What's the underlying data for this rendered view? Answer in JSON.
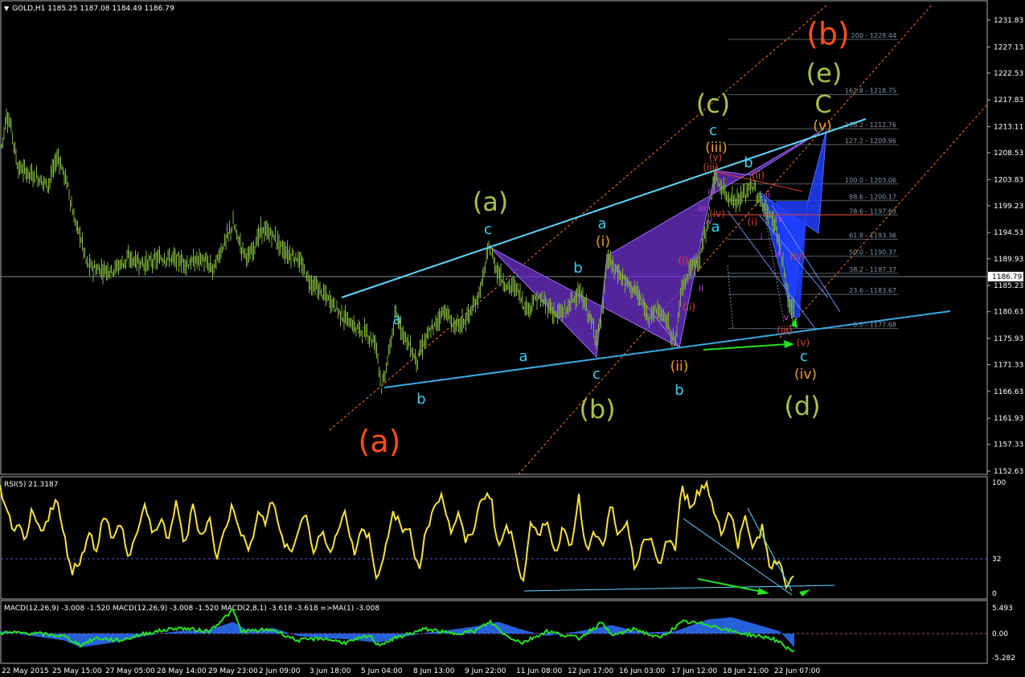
{
  "header": {
    "symbol_line": "GOLD,H1  1185.25 1187.08 1184.49 1186.79",
    "current_price": "1186.79"
  },
  "colors": {
    "background": "#000000",
    "candles": "#7fb33b",
    "trendline": "#5fd7ff",
    "pattern_purple": "#6a2fc7",
    "pattern_blue": "#1e40ff",
    "rsi": "#f5e33d",
    "macd_hist": "#2b6cf2",
    "macd_signal": "#28e028",
    "fib_channel": "#ff7f27",
    "wave_major": "#ff4f1a",
    "wave_green": "#a8c24a",
    "wave_cyan": "#38d0f0",
    "wave_orange": "#f0a020",
    "wave_red": "#e0402c",
    "wave_magenta": "#c040e0",
    "arrow_green": "#22e022"
  },
  "chart_data": [
    {
      "type": "candlestick",
      "title": "GOLD,H1",
      "ohlc_current": {
        "open": 1185.25,
        "high": 1187.08,
        "low": 1184.49,
        "close": 1186.79
      },
      "ylim": [
        1150.0,
        1234.5
      ],
      "y_ticks": [
        "1231.83",
        "1227.13",
        "1222.53",
        "1217.83",
        "1213.11",
        "1208.53",
        "1203.83",
        "1199.23",
        "1194.53",
        "1189.93",
        "1185.23",
        "1180.63",
        "1175.93",
        "1171.33",
        "1166.63",
        "1161.93",
        "1157.33",
        "1152.63"
      ],
      "x_ticks": [
        "22 May 2015",
        "25 May 15:00",
        "27 May 05:00",
        "28 May 14:00",
        "29 May 23:00",
        "2 Jun 09:00",
        "3 Jun 18:00",
        "5 Jun 04:00",
        "8 Jun 13:00",
        "9 Jun 22:00",
        "11 Jun 08:00",
        "12 Jun 17:00",
        "16 Jun 03:00",
        "17 Jun 12:00",
        "18 Jun 21:00",
        "22 Jun 07:00"
      ],
      "price_path": [
        [
          0,
          1208.0
        ],
        [
          8,
          1215.0
        ],
        [
          14,
          1213.0
        ],
        [
          22,
          1206.0
        ],
        [
          35,
          1205.0
        ],
        [
          48,
          1204.0
        ],
        [
          60,
          1203.0
        ],
        [
          72,
          1208.0
        ],
        [
          84,
          1203.0
        ],
        [
          92,
          1197.0
        ],
        [
          100,
          1194.0
        ],
        [
          108,
          1189.0
        ],
        [
          120,
          1188.0
        ],
        [
          140,
          1188.0
        ],
        [
          160,
          1190.0
        ],
        [
          180,
          1189.0
        ],
        [
          200,
          1190.0
        ],
        [
          215,
          1190.0
        ],
        [
          235,
          1189.0
        ],
        [
          250,
          1190.0
        ],
        [
          265,
          1188.0
        ],
        [
          280,
          1193.0
        ],
        [
          290,
          1196.0
        ],
        [
          300,
          1192.0
        ],
        [
          310,
          1190.0
        ],
        [
          325,
          1195.0
        ],
        [
          340,
          1194.0
        ],
        [
          355,
          1191.0
        ],
        [
          370,
          1190.0
        ],
        [
          385,
          1186.0
        ],
        [
          400,
          1184.0
        ],
        [
          415,
          1182.0
        ],
        [
          425,
          1180.0
        ],
        [
          440,
          1178.0
        ],
        [
          455,
          1177.0
        ],
        [
          468,
          1175.0
        ],
        [
          475,
          1167.0
        ],
        [
          482,
          1172.0
        ],
        [
          492,
          1180.0
        ],
        [
          505,
          1176.0
        ],
        [
          518,
          1172.0
        ],
        [
          530,
          1176.0
        ],
        [
          540,
          1178.0
        ],
        [
          552,
          1181.0
        ],
        [
          565,
          1178.0
        ],
        [
          578,
          1179.0
        ],
        [
          592,
          1182.0
        ],
        [
          600,
          1186.0
        ],
        [
          608,
          1192.0
        ],
        [
          618,
          1188.0
        ],
        [
          630,
          1185.0
        ],
        [
          642,
          1185.0
        ],
        [
          655,
          1181.0
        ],
        [
          668,
          1183.0
        ],
        [
          680,
          1182.0
        ],
        [
          692,
          1180.0
        ],
        [
          705,
          1181.0
        ],
        [
          718,
          1184.0
        ],
        [
          728,
          1182.0
        ],
        [
          735,
          1179.0
        ],
        [
          742,
          1176.0
        ],
        [
          750,
          1181.0
        ],
        [
          755,
          1190.0
        ],
        [
          765,
          1188.0
        ],
        [
          778,
          1186.0
        ],
        [
          792,
          1184.0
        ],
        [
          805,
          1180.0
        ],
        [
          818,
          1181.0
        ],
        [
          830,
          1179.0
        ],
        [
          840,
          1175.0
        ],
        [
          848,
          1185.0
        ],
        [
          858,
          1188.0
        ],
        [
          870,
          1190.0
        ],
        [
          880,
          1196.0
        ],
        [
          888,
          1204.0
        ],
        [
          895,
          1203.0
        ],
        [
          905,
          1201.0
        ],
        [
          915,
          1200.0
        ],
        [
          925,
          1201.0
        ],
        [
          935,
          1203.0
        ],
        [
          945,
          1200.0
        ],
        [
          955,
          1198.0
        ],
        [
          965,
          1196.0
        ],
        [
          975,
          1188.0
        ],
        [
          983,
          1181.0
        ],
        [
          990,
          1181.0
        ]
      ],
      "annotations": {
        "major_b": "(b)",
        "major_a": "(a)",
        "wave_e": "(e)",
        "wave_d": "(d)",
        "wave_c_big": "(c)",
        "wave_a_big": "(a)",
        "wave_b_big": "(b)",
        "big_C": "C",
        "cyan_c1": "c",
        "cyan_a1": "a",
        "cyan_b1": "b",
        "cyan_a2": "a",
        "cyan_c2": "c",
        "cyan_b2": "b",
        "cyan_a3": "a",
        "cyan_b3": "b",
        "cyan_c3": "c",
        "cyan_a4": "a",
        "cyan_c4": "c",
        "cyan_b4": "b",
        "orange_i": "(i)",
        "orange_ii": "(ii)",
        "orange_iii": "(iii)",
        "orange_iv": "(iv)",
        "orange_v": "(v)",
        "red_i1": "(i)",
        "red_ii1": "(ii)",
        "red_iii1": "(iii)",
        "red_iv1": "(iv)",
        "red_v1": "(v)",
        "red_i2": "(i)",
        "red_ii2": "(ii)",
        "red_iii2": "(iii)",
        "red_iv2": "(iv)",
        "red_v2": "(v)",
        "mag_i1": "i",
        "mag_ii1": "ii",
        "mag_iii1": "iii",
        "mag_iv1": "iv",
        "mag_v1": "v",
        "mag_i2": "i",
        "mag_ii2": "ii",
        "mag_iii2": "iii",
        "mag_iv2": "iv",
        "mag_v2": "v"
      },
      "fib_levels": [
        {
          "label": "200 - 1228.44",
          "value": 1228.44
        },
        {
          "label": "161.8 - 1218.75",
          "value": 1218.75
        },
        {
          "label": "138.2 - 1212.76",
          "value": 1212.76
        },
        {
          "label": "127.2 - 1209.96",
          "value": 1209.96
        },
        {
          "label": "100.0 - 1203.06",
          "value": 1203.06
        },
        {
          "label": "88.6 - 1200.17",
          "value": 1200.17
        },
        {
          "label": "78.6 - 1197.63",
          "value": 1197.63
        },
        {
          "label": "61.8 - 1193.36",
          "value": 1193.36
        },
        {
          "label": "50.0 - 1190.37",
          "value": 1190.37
        },
        {
          "label": "38.2 - 1187.37",
          "value": 1187.37
        },
        {
          "label": "23.6 - 1183.67",
          "value": 1183.67
        },
        {
          "label": "0.0 - 1177.68",
          "value": 1177.68
        }
      ]
    },
    {
      "type": "line",
      "title": "RSI(5) 21.3187",
      "ylim": [
        0,
        100
      ],
      "y_ticks": [
        "100",
        "32",
        "0"
      ],
      "level": 32,
      "path": [
        [
          0,
          95
        ],
        [
          8,
          80
        ],
        [
          16,
          50
        ],
        [
          24,
          60
        ],
        [
          32,
          45
        ],
        [
          40,
          75
        ],
        [
          50,
          55
        ],
        [
          60,
          70
        ],
        [
          70,
          85
        ],
        [
          80,
          50
        ],
        [
          90,
          20
        ],
        [
          100,
          30
        ],
        [
          110,
          55
        ],
        [
          120,
          40
        ],
        [
          130,
          75
        ],
        [
          140,
          45
        ],
        [
          150,
          65
        ],
        [
          160,
          30
        ],
        [
          170,
          55
        ],
        [
          180,
          80
        ],
        [
          190,
          50
        ],
        [
          200,
          70
        ],
        [
          210,
          45
        ],
        [
          220,
          85
        ],
        [
          230,
          40
        ],
        [
          240,
          80
        ],
        [
          250,
          50
        ],
        [
          260,
          70
        ],
        [
          270,
          30
        ],
        [
          280,
          60
        ],
        [
          290,
          80
        ],
        [
          300,
          55
        ],
        [
          310,
          35
        ],
        [
          320,
          75
        ],
        [
          330,
          65
        ],
        [
          340,
          85
        ],
        [
          350,
          50
        ],
        [
          360,
          35
        ],
        [
          370,
          55
        ],
        [
          380,
          75
        ],
        [
          390,
          35
        ],
        [
          400,
          55
        ],
        [
          410,
          40
        ],
        [
          420,
          55
        ],
        [
          430,
          75
        ],
        [
          440,
          35
        ],
        [
          450,
          60
        ],
        [
          460,
          50
        ],
        [
          470,
          10
        ],
        [
          480,
          40
        ],
        [
          490,
          75
        ],
        [
          500,
          55
        ],
        [
          510,
          60
        ],
        [
          520,
          20
        ],
        [
          530,
          55
        ],
        [
          540,
          80
        ],
        [
          550,
          90
        ],
        [
          560,
          55
        ],
        [
          570,
          70
        ],
        [
          580,
          45
        ],
        [
          590,
          60
        ],
        [
          600,
          88
        ],
        [
          610,
          90
        ],
        [
          620,
          40
        ],
        [
          630,
          60
        ],
        [
          640,
          45
        ],
        [
          650,
          10
        ],
        [
          660,
          60
        ],
        [
          670,
          50
        ],
        [
          680,
          70
        ],
        [
          690,
          35
        ],
        [
          700,
          60
        ],
        [
          710,
          45
        ],
        [
          720,
          85
        ],
        [
          730,
          35
        ],
        [
          740,
          55
        ],
        [
          750,
          40
        ],
        [
          760,
          80
        ],
        [
          770,
          50
        ],
        [
          780,
          60
        ],
        [
          790,
          20
        ],
        [
          800,
          50
        ],
        [
          810,
          45
        ],
        [
          820,
          25
        ],
        [
          830,
          50
        ],
        [
          840,
          40
        ],
        [
          848,
          95
        ],
        [
          858,
          80
        ],
        [
          868,
          90
        ],
        [
          878,
          100
        ],
        [
          888,
          75
        ],
        [
          898,
          55
        ],
        [
          908,
          75
        ],
        [
          918,
          45
        ],
        [
          928,
          70
        ],
        [
          938,
          40
        ],
        [
          948,
          60
        ],
        [
          958,
          25
        ],
        [
          968,
          30
        ],
        [
          976,
          10
        ],
        [
          982,
          5
        ],
        [
          988,
          21
        ]
      ]
    },
    {
      "type": "histogram",
      "title": "MACD(12,26,9) -3.008 -1.520  MACD(12,26,9) -3.008 -1.520  MACD(2,8,1) -3.618 -3.618  =>MA(1) -3.008",
      "y_ticks": [
        "5.493",
        "0.00",
        "-5.282"
      ],
      "ylim": [
        -6.0,
        6.5
      ],
      "macd_path": [
        [
          0,
          0.5
        ],
        [
          40,
          -0.5
        ],
        [
          80,
          -1.5
        ],
        [
          100,
          -3.0
        ],
        [
          140,
          -2.0
        ],
        [
          180,
          -0.5
        ],
        [
          220,
          0.5
        ],
        [
          260,
          0.8
        ],
        [
          290,
          2.5
        ],
        [
          310,
          0.5
        ],
        [
          340,
          1.2
        ],
        [
          370,
          -0.5
        ],
        [
          400,
          -1.0
        ],
        [
          430,
          -1.2
        ],
        [
          470,
          -2.0
        ],
        [
          500,
          -0.8
        ],
        [
          530,
          0.2
        ],
        [
          560,
          0.8
        ],
        [
          590,
          1.5
        ],
        [
          620,
          2.5
        ],
        [
          650,
          0.8
        ],
        [
          680,
          -0.5
        ],
        [
          720,
          0.5
        ],
        [
          760,
          1.8
        ],
        [
          800,
          0.2
        ],
        [
          840,
          0.5
        ],
        [
          880,
          3.0
        ],
        [
          910,
          3.5
        ],
        [
          940,
          2.0
        ],
        [
          970,
          0.5
        ],
        [
          988,
          -3.0
        ]
      ],
      "signal_path": [
        [
          0,
          0.2
        ],
        [
          40,
          0.1
        ],
        [
          80,
          -0.6
        ],
        [
          100,
          -2.5
        ],
        [
          120,
          -1.0
        ],
        [
          150,
          -1.5
        ],
        [
          180,
          0.0
        ],
        [
          220,
          1.2
        ],
        [
          260,
          0.5
        ],
        [
          290,
          5.0
        ],
        [
          300,
          0.5
        ],
        [
          340,
          0.8
        ],
        [
          370,
          -1.5
        ],
        [
          400,
          -1.0
        ],
        [
          430,
          -2.0
        ],
        [
          460,
          -0.5
        ],
        [
          470,
          -2.5
        ],
        [
          500,
          -0.5
        ],
        [
          530,
          1.0
        ],
        [
          560,
          0.0
        ],
        [
          590,
          0.5
        ],
        [
          610,
          2.5
        ],
        [
          630,
          -0.5
        ],
        [
          650,
          -2.0
        ],
        [
          680,
          0.5
        ],
        [
          720,
          -1.0
        ],
        [
          750,
          2.5
        ],
        [
          760,
          -0.5
        ],
        [
          790,
          1.0
        ],
        [
          820,
          -1.0
        ],
        [
          850,
          2.5
        ],
        [
          880,
          2.0
        ],
        [
          910,
          0.5
        ],
        [
          940,
          -0.5
        ],
        [
          960,
          -1.0
        ],
        [
          988,
          -4.0
        ]
      ]
    }
  ]
}
